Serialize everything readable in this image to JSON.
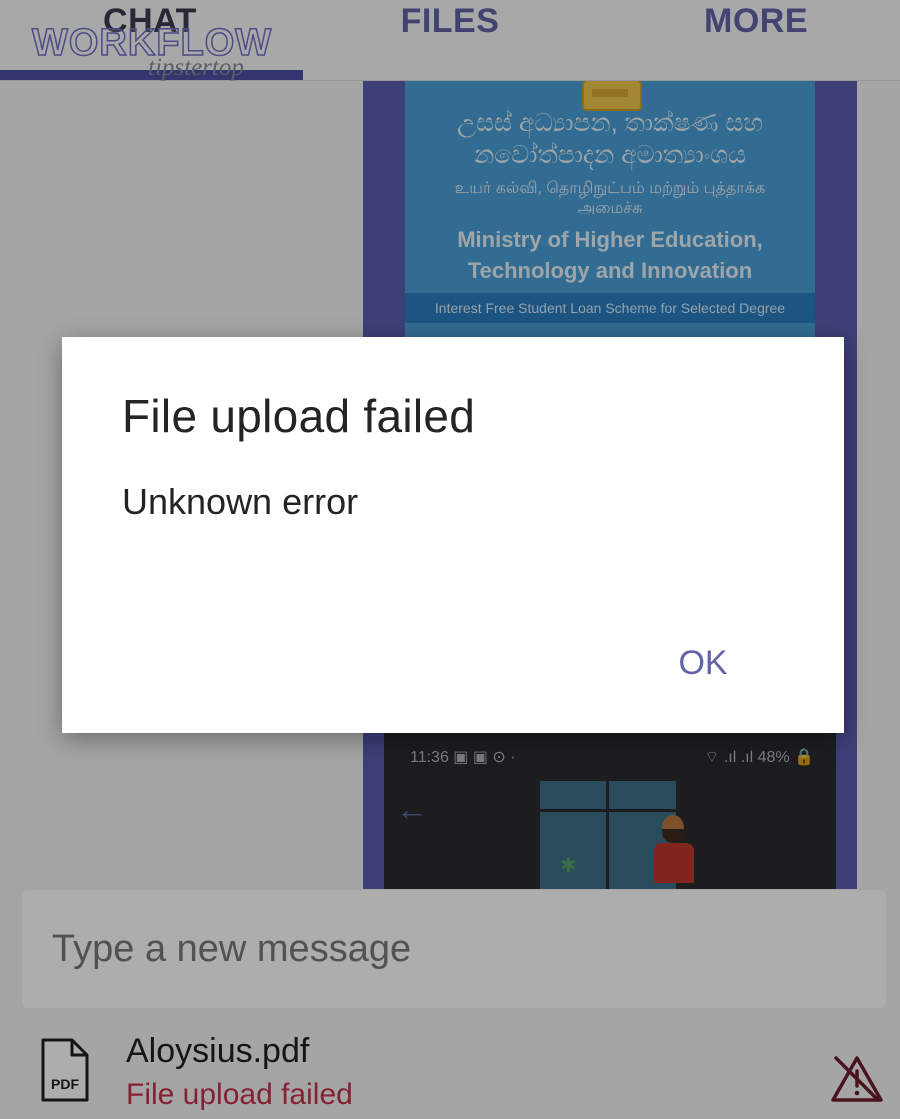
{
  "tabs": {
    "chat": "CHAT",
    "files": "FILES",
    "more": "MORE"
  },
  "watermark": {
    "main": "WORKFLOW",
    "sub": "tipstertop"
  },
  "chat": {
    "poster": {
      "sinhala_line1": "උසස් අධ්‍යාපන, තාක්ෂණ සහ",
      "sinhala_line2": "නවෝත්පාදන අමාත්‍යාංශය",
      "tamil_line1": "உயர் கல்வி, தொழிநுட்பம் மற்றும் புத்தாக்க",
      "tamil_line2": "அமைச்சு",
      "english_line1": "Ministry of Higher Education,",
      "english_line2": "Technology and Innovation",
      "banner": "Interest Free Student Loan Scheme for Selected Degree"
    },
    "phone_screenshot": {
      "time": "11:36 ▣ ▣ ⊙ ·",
      "status": "⌔ .ıl .ıl 48% 🔒",
      "back_arrow": "←"
    }
  },
  "compose": {
    "placeholder": "Type a new message"
  },
  "attachment": {
    "icon_label": "PDF",
    "file_name": "Aloysius.pdf",
    "status": "File upload failed",
    "status_color": "#c4314b"
  },
  "dialog": {
    "title": "File upload failed",
    "message": "Unknown error",
    "ok_label": "OK"
  },
  "colors": {
    "accent": "#6264a7",
    "error": "#c4314b"
  }
}
